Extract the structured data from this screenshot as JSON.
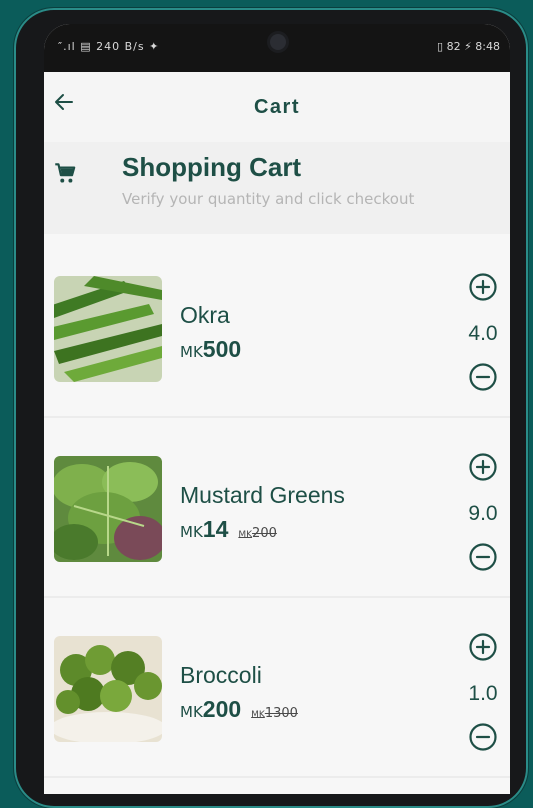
{
  "status_bar": {
    "left": "″.ıl ▤ 240 B/s ✦",
    "right": "▯ 82 ⚡ 8:48"
  },
  "appbar": {
    "title": "Cart"
  },
  "header": {
    "title": "Shopping Cart",
    "subtitle": "Verify your quantity and click checkout"
  },
  "items": [
    {
      "name": "Okra",
      "currency": "MK",
      "price": "500",
      "old_currency": "",
      "old_price": "",
      "quantity": "4.0"
    },
    {
      "name": "Mustard Greens",
      "currency": "MK",
      "price": "14",
      "old_currency": "MK",
      "old_price": "200",
      "quantity": "9.0"
    },
    {
      "name": "Broccoli",
      "currency": "MK",
      "price": "200",
      "old_currency": "MK",
      "old_price": "1300",
      "quantity": "1.0"
    }
  ],
  "colors": {
    "primary": "#1e4f46",
    "background": "#0b5c5a"
  },
  "icons": {
    "back": "arrow-left-icon",
    "cart": "cart-icon",
    "plus": "plus-circle-icon",
    "minus": "minus-circle-icon"
  }
}
